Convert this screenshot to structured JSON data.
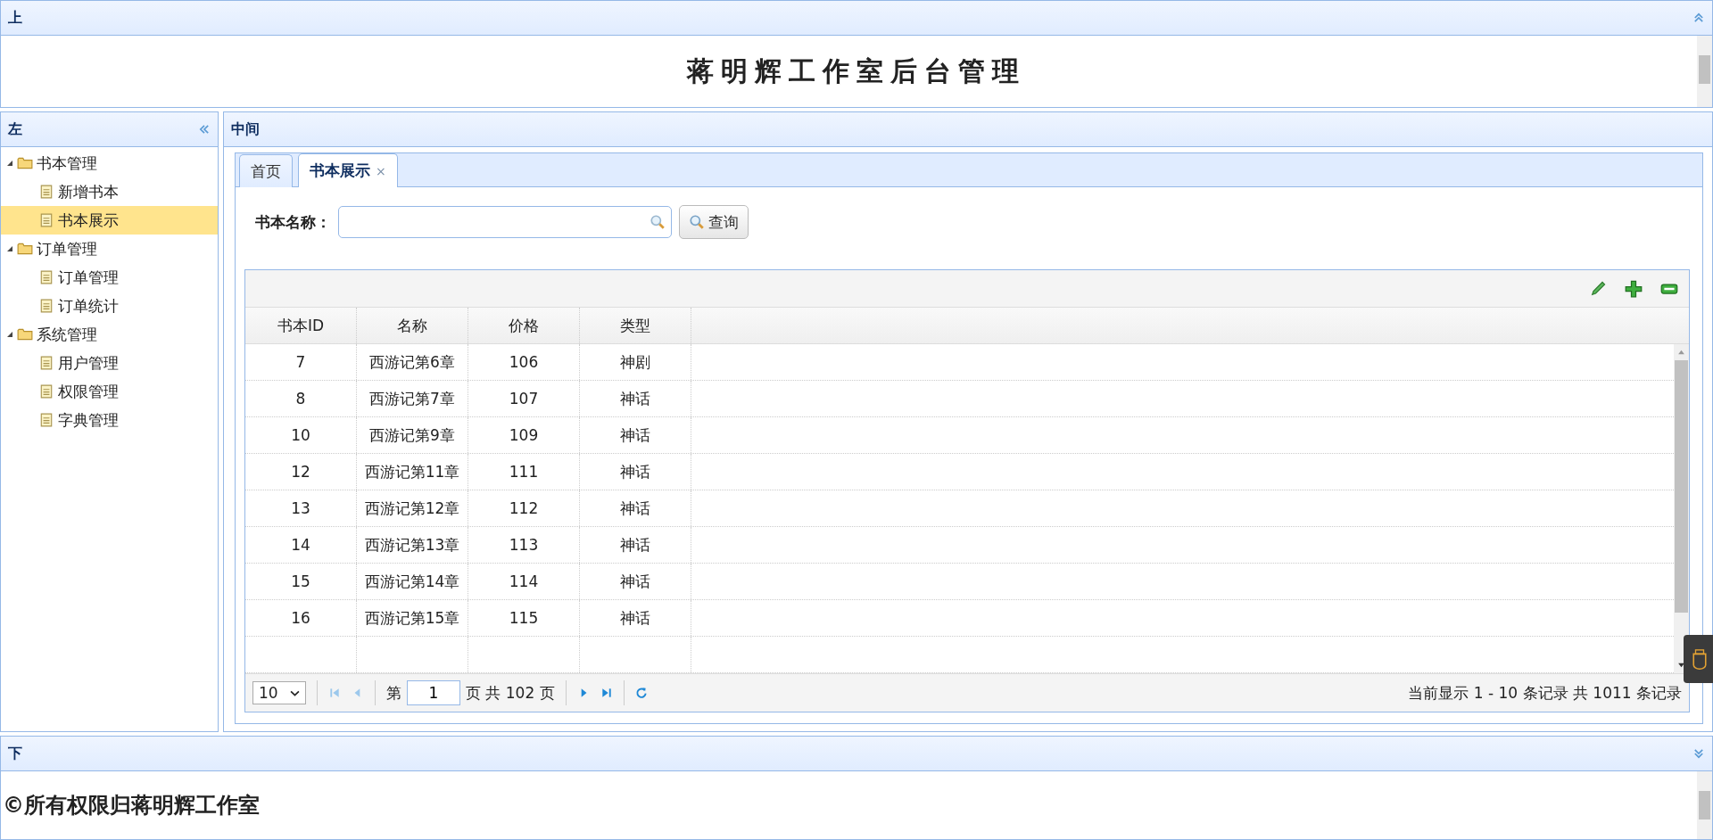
{
  "top_panel": {
    "title": "上",
    "heading": "蒋明辉工作室后台管理"
  },
  "left_panel": {
    "title": "左",
    "tree": [
      {
        "label": "书本管理",
        "expanded": true,
        "selected": false,
        "children": [
          {
            "label": "新增书本",
            "selected": false
          },
          {
            "label": "书本展示",
            "selected": true
          }
        ]
      },
      {
        "label": "订单管理",
        "expanded": true,
        "selected": false,
        "children": [
          {
            "label": "订单管理",
            "selected": false
          },
          {
            "label": "订单统计",
            "selected": false
          }
        ]
      },
      {
        "label": "系统管理",
        "expanded": true,
        "selected": false,
        "children": [
          {
            "label": "用户管理",
            "selected": false
          },
          {
            "label": "权限管理",
            "selected": false
          },
          {
            "label": "字典管理",
            "selected": false
          }
        ]
      }
    ]
  },
  "center_panel": {
    "title": "中间",
    "tabs": [
      {
        "label": "首页",
        "selected": false
      },
      {
        "label": "书本展示",
        "selected": true,
        "close": "×"
      }
    ],
    "search": {
      "label": "书本名称：",
      "button": "查询"
    },
    "grid": {
      "columns": [
        "书本ID",
        "名称",
        "价格",
        "类型"
      ],
      "rows": [
        [
          "7",
          "西游记第6章",
          "106",
          "神剧"
        ],
        [
          "8",
          "西游记第7章",
          "107",
          "神话"
        ],
        [
          "10",
          "西游记第9章",
          "109",
          "神话"
        ],
        [
          "12",
          "西游记第11章",
          "111",
          "神话"
        ],
        [
          "13",
          "西游记第12章",
          "112",
          "神话"
        ],
        [
          "14",
          "西游记第13章",
          "113",
          "神话"
        ],
        [
          "15",
          "西游记第14章",
          "114",
          "神话"
        ],
        [
          "16",
          "西游记第15章",
          "115",
          "神话"
        ]
      ],
      "pager": {
        "page_size": "10",
        "before_page": "第",
        "page": "1",
        "after_page": "页 共 102 页",
        "info": "当前显示 1 - 10 条记录 共 1011 条记录"
      }
    }
  },
  "bottom_panel": {
    "title": "下",
    "footer": "©所有权限归蒋明辉工作室"
  }
}
